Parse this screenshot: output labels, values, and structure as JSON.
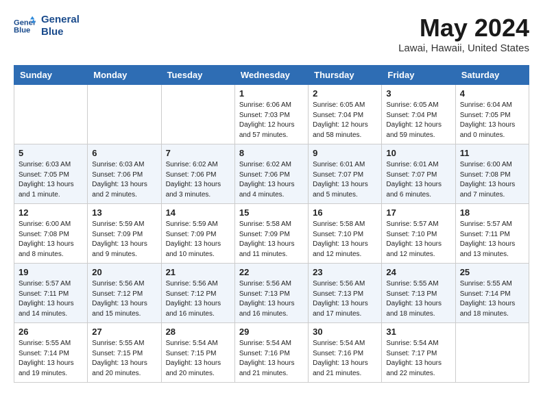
{
  "header": {
    "logo_line1": "General",
    "logo_line2": "Blue",
    "month": "May 2024",
    "location": "Lawai, Hawaii, United States"
  },
  "weekdays": [
    "Sunday",
    "Monday",
    "Tuesday",
    "Wednesday",
    "Thursday",
    "Friday",
    "Saturday"
  ],
  "weeks": [
    [
      {
        "day": "",
        "info": ""
      },
      {
        "day": "",
        "info": ""
      },
      {
        "day": "",
        "info": ""
      },
      {
        "day": "1",
        "info": "Sunrise: 6:06 AM\nSunset: 7:03 PM\nDaylight: 12 hours\nand 57 minutes."
      },
      {
        "day": "2",
        "info": "Sunrise: 6:05 AM\nSunset: 7:04 PM\nDaylight: 12 hours\nand 58 minutes."
      },
      {
        "day": "3",
        "info": "Sunrise: 6:05 AM\nSunset: 7:04 PM\nDaylight: 12 hours\nand 59 minutes."
      },
      {
        "day": "4",
        "info": "Sunrise: 6:04 AM\nSunset: 7:05 PM\nDaylight: 13 hours\nand 0 minutes."
      }
    ],
    [
      {
        "day": "5",
        "info": "Sunrise: 6:03 AM\nSunset: 7:05 PM\nDaylight: 13 hours\nand 1 minute."
      },
      {
        "day": "6",
        "info": "Sunrise: 6:03 AM\nSunset: 7:06 PM\nDaylight: 13 hours\nand 2 minutes."
      },
      {
        "day": "7",
        "info": "Sunrise: 6:02 AM\nSunset: 7:06 PM\nDaylight: 13 hours\nand 3 minutes."
      },
      {
        "day": "8",
        "info": "Sunrise: 6:02 AM\nSunset: 7:06 PM\nDaylight: 13 hours\nand 4 minutes."
      },
      {
        "day": "9",
        "info": "Sunrise: 6:01 AM\nSunset: 7:07 PM\nDaylight: 13 hours\nand 5 minutes."
      },
      {
        "day": "10",
        "info": "Sunrise: 6:01 AM\nSunset: 7:07 PM\nDaylight: 13 hours\nand 6 minutes."
      },
      {
        "day": "11",
        "info": "Sunrise: 6:00 AM\nSunset: 7:08 PM\nDaylight: 13 hours\nand 7 minutes."
      }
    ],
    [
      {
        "day": "12",
        "info": "Sunrise: 6:00 AM\nSunset: 7:08 PM\nDaylight: 13 hours\nand 8 minutes."
      },
      {
        "day": "13",
        "info": "Sunrise: 5:59 AM\nSunset: 7:09 PM\nDaylight: 13 hours\nand 9 minutes."
      },
      {
        "day": "14",
        "info": "Sunrise: 5:59 AM\nSunset: 7:09 PM\nDaylight: 13 hours\nand 10 minutes."
      },
      {
        "day": "15",
        "info": "Sunrise: 5:58 AM\nSunset: 7:09 PM\nDaylight: 13 hours\nand 11 minutes."
      },
      {
        "day": "16",
        "info": "Sunrise: 5:58 AM\nSunset: 7:10 PM\nDaylight: 13 hours\nand 12 minutes."
      },
      {
        "day": "17",
        "info": "Sunrise: 5:57 AM\nSunset: 7:10 PM\nDaylight: 13 hours\nand 12 minutes."
      },
      {
        "day": "18",
        "info": "Sunrise: 5:57 AM\nSunset: 7:11 PM\nDaylight: 13 hours\nand 13 minutes."
      }
    ],
    [
      {
        "day": "19",
        "info": "Sunrise: 5:57 AM\nSunset: 7:11 PM\nDaylight: 13 hours\nand 14 minutes."
      },
      {
        "day": "20",
        "info": "Sunrise: 5:56 AM\nSunset: 7:12 PM\nDaylight: 13 hours\nand 15 minutes."
      },
      {
        "day": "21",
        "info": "Sunrise: 5:56 AM\nSunset: 7:12 PM\nDaylight: 13 hours\nand 16 minutes."
      },
      {
        "day": "22",
        "info": "Sunrise: 5:56 AM\nSunset: 7:13 PM\nDaylight: 13 hours\nand 16 minutes."
      },
      {
        "day": "23",
        "info": "Sunrise: 5:56 AM\nSunset: 7:13 PM\nDaylight: 13 hours\nand 17 minutes."
      },
      {
        "day": "24",
        "info": "Sunrise: 5:55 AM\nSunset: 7:13 PM\nDaylight: 13 hours\nand 18 minutes."
      },
      {
        "day": "25",
        "info": "Sunrise: 5:55 AM\nSunset: 7:14 PM\nDaylight: 13 hours\nand 18 minutes."
      }
    ],
    [
      {
        "day": "26",
        "info": "Sunrise: 5:55 AM\nSunset: 7:14 PM\nDaylight: 13 hours\nand 19 minutes."
      },
      {
        "day": "27",
        "info": "Sunrise: 5:55 AM\nSunset: 7:15 PM\nDaylight: 13 hours\nand 20 minutes."
      },
      {
        "day": "28",
        "info": "Sunrise: 5:54 AM\nSunset: 7:15 PM\nDaylight: 13 hours\nand 20 minutes."
      },
      {
        "day": "29",
        "info": "Sunrise: 5:54 AM\nSunset: 7:16 PM\nDaylight: 13 hours\nand 21 minutes."
      },
      {
        "day": "30",
        "info": "Sunrise: 5:54 AM\nSunset: 7:16 PM\nDaylight: 13 hours\nand 21 minutes."
      },
      {
        "day": "31",
        "info": "Sunrise: 5:54 AM\nSunset: 7:17 PM\nDaylight: 13 hours\nand 22 minutes."
      },
      {
        "day": "",
        "info": ""
      }
    ]
  ]
}
